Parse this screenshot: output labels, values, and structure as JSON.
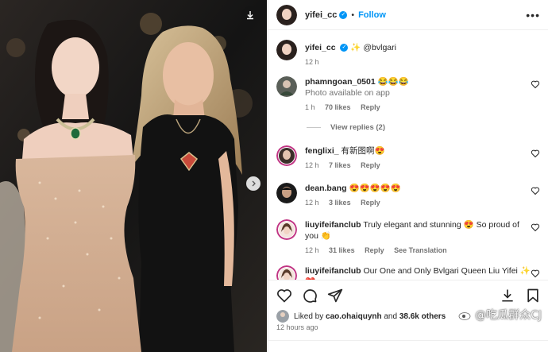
{
  "post": {
    "username": "yifei_cc",
    "follow_label": "Follow",
    "more_label": "•••",
    "caption_tag": "@bvlgari",
    "caption_sparkle": "✨",
    "caption_time": "12 h"
  },
  "comments": [
    {
      "user": "phamngoan_0501",
      "text": "😂😂😂",
      "sub": "Photo available on app",
      "time": "1 h",
      "likes": "70 likes",
      "reply": "Reply"
    },
    {
      "user": "fenglixi_",
      "text": "有新图啊😍",
      "time": "12 h",
      "likes": "7 likes",
      "reply": "Reply"
    },
    {
      "user": "dean.bang",
      "text": "😍😍😍😍😍",
      "time": "12 h",
      "likes": "3 likes",
      "reply": "Reply"
    },
    {
      "user": "liuyifeifanclub",
      "text": "Truly elegant and stunning 😍 So proud of you 👏",
      "time": "12 h",
      "likes": "31 likes",
      "reply": "Reply",
      "extra": "See Translation"
    },
    {
      "user": "liuyifeifanclub",
      "text": "Our One and Only Bvlgari Queen Liu Yifei ✨❤️"
    }
  ],
  "view_replies": "View replies (2)",
  "likes": {
    "prefix": "Liked by",
    "user": "cao.ohaiquynh",
    "and": "and",
    "others": "38.6k others"
  },
  "time_ago": "12 hours ago",
  "watermark": "@吃瓜群众CJ",
  "colors": {
    "accent": "#0095f6",
    "verified": "#0095f6",
    "text": "#262626",
    "muted": "#737373"
  },
  "icons": [
    "download-icon",
    "chevron-right-icon",
    "verified-icon",
    "heart-icon",
    "comment-icon",
    "share-icon",
    "bookmark-icon"
  ]
}
